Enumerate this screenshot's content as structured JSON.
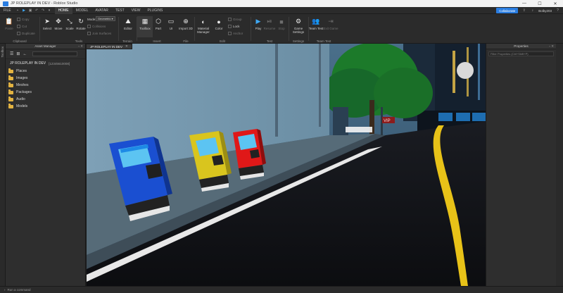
{
  "window": {
    "title": "JP ROLEPLAY IN DEV - Roblox Studio",
    "controls": {
      "minimize": "—",
      "maximize": "☐",
      "close": "✕"
    }
  },
  "menubar": {
    "file_label": "FILE",
    "tabs": [
      "HOME",
      "MODEL",
      "AVATAR",
      "TEST",
      "VIEW",
      "PLUGINS"
    ],
    "active_tab": "HOME",
    "collaborate_label": "Collaborate",
    "username": "Bolby203"
  },
  "ribbon": {
    "clipboard": {
      "label": "Clipboard",
      "paste": "Paste",
      "copy": "Copy",
      "cut": "Cut",
      "duplicate": "Duplicate"
    },
    "tools": {
      "label": "Tools",
      "select": "Select",
      "move": "Move",
      "scale": "Scale",
      "rotate": "Rotate",
      "mode_label": "Mode:",
      "mode_value": "Geometric",
      "collisions": "Collisions",
      "join_surfaces": "Join Surfaces"
    },
    "terrain": {
      "label": "Terrain",
      "editor": "Editor"
    },
    "insert": {
      "label": "Insert",
      "toolbox": "Toolbox",
      "part": "Part",
      "ui": "UI",
      "import3d": "Import 3D"
    },
    "file": {
      "label": "File"
    },
    "edit": {
      "label": "Edit",
      "material_manager": "Material Manager",
      "color": "Color",
      "group": "Group",
      "lock": "Lock",
      "anchor": "Anchor"
    },
    "test": {
      "label": "Test",
      "play": "Play",
      "resume": "Resume",
      "stop": "Stop"
    },
    "settings": {
      "label": "Settings",
      "game_settings": "Game Settings"
    },
    "team_test": {
      "label": "Team Test",
      "team_test": "Team Test",
      "exit_game": "Exit Game"
    }
  },
  "left_strip": {
    "tab": "Toolbox"
  },
  "asset_manager": {
    "title": "Asset Manager",
    "place_name": "JP ROLEPLAY IN DEV",
    "place_id": "[12345610008]",
    "folders": [
      "Places",
      "Images",
      "Meshes",
      "Packages",
      "Audio",
      "Models"
    ]
  },
  "viewport": {
    "tab_label": "JP ROLEPLAY IN DEV",
    "sign_text": "VIP"
  },
  "properties": {
    "title": "Properties",
    "filter_placeholder": "Filter Properties (Ctrl+Shift+P)"
  },
  "command_bar": {
    "placeholder": "Run a command"
  },
  "colors": {
    "accent": "#2a7de1",
    "kiosk_blue": "#1a4fd1",
    "kiosk_yellow": "#d9c51e",
    "kiosk_red": "#e01818",
    "folder": "#e3b341",
    "road_line_yellow": "#e8c218"
  }
}
